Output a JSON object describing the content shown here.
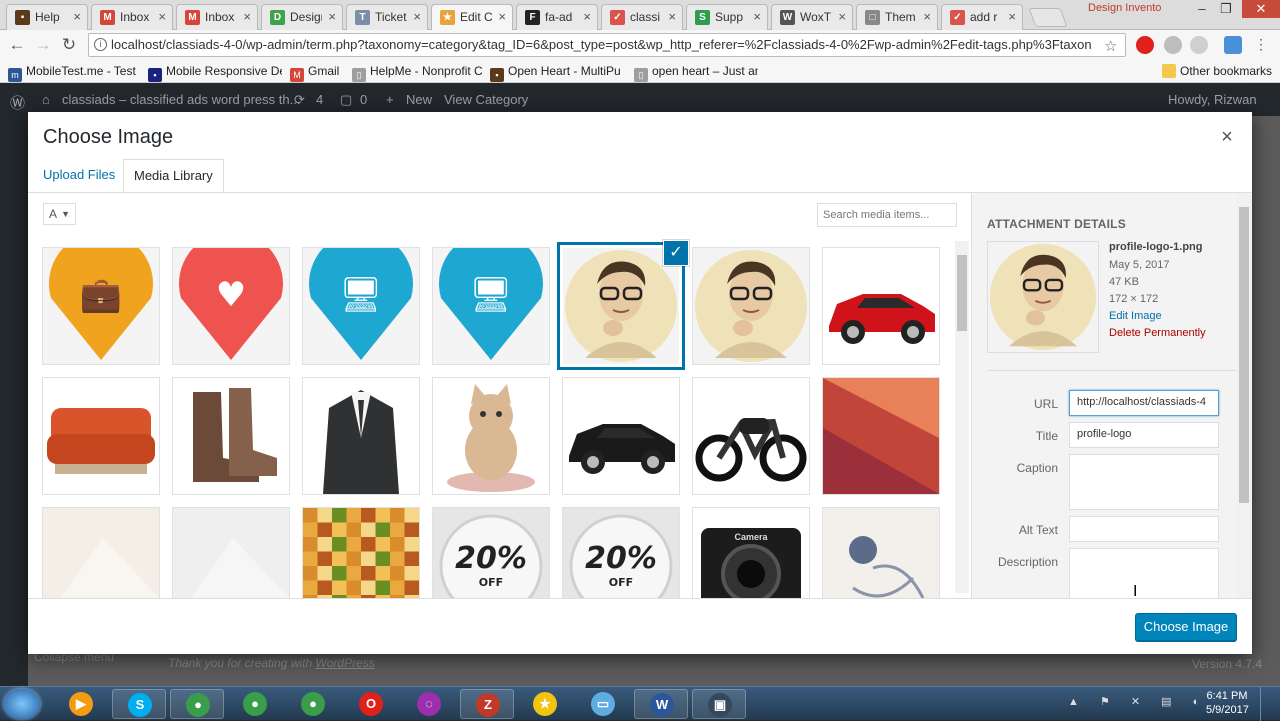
{
  "browser": {
    "tabs": [
      {
        "label": "Help",
        "fav_color": "#5a3a1a",
        "fav": "▪"
      },
      {
        "label": "Inbox",
        "fav_color": "#d44638",
        "fav": "M"
      },
      {
        "label": "Inbox",
        "fav_color": "#d44638",
        "fav": "M"
      },
      {
        "label": "Design",
        "fav_color": "#3ea34a",
        "fav": "D"
      },
      {
        "label": "Ticket",
        "fav_color": "#7a8ea8",
        "fav": "T"
      },
      {
        "label": "Edit C",
        "fav_color": "#e8a33a",
        "fav": "★",
        "active": true
      },
      {
        "label": "fa-ad",
        "fav_color": "#222222",
        "fav": "F"
      },
      {
        "label": "classi",
        "fav_color": "#d9534f",
        "fav": "✓"
      },
      {
        "label": "Supp",
        "fav_color": "#2e9e4d",
        "fav": "S"
      },
      {
        "label": "WoxT",
        "fav_color": "#555555",
        "fav": "W"
      },
      {
        "label": "Them",
        "fav_color": "#888888",
        "fav": "□"
      },
      {
        "label": "add r",
        "fav_color": "#d9534f",
        "fav": "✓"
      }
    ],
    "tab_close": "×",
    "profile_label": "Design Invento",
    "window_controls": {
      "minimize": "–",
      "restore": "❐",
      "close": "✕"
    },
    "nav": {
      "back": "←",
      "forward": "→",
      "reload": "↻"
    },
    "url": "localhost/classiads-4-0/wp-admin/term.php?taxonomy=category&tag_ID=6&post_type=post&wp_http_referer=%2Fclassiads-4-0%2Fwp-admin%2Fedit-tags.php%3Ftaxon",
    "info_icon": "i",
    "star_icon": "☆",
    "bookmarks": [
      {
        "label": "MobileTest.me - Test",
        "color": "#2b5797",
        "fav": "m"
      },
      {
        "label": "Mobile Responsive De",
        "color": "#1a237e",
        "fav": "▪"
      },
      {
        "label": "Gmail",
        "color": "#d44638",
        "fav": "M"
      },
      {
        "label": "HelpMe - Nonprofit C",
        "color": "#9e9e9e",
        "fav": "▯"
      },
      {
        "label": "Open Heart - MultiPu",
        "color": "#5a3a1a",
        "fav": "▪"
      },
      {
        "label": "open heart – Just ano",
        "color": "#9e9e9e",
        "fav": "▯"
      }
    ],
    "other_bookmarks": "Other bookmarks"
  },
  "adminbar": {
    "site": "classiads – classified ads word press th...",
    "updates": "4",
    "comments": "0",
    "new": "New",
    "view": "View Category",
    "howdy": "Howdy, Rizwan"
  },
  "footer": {
    "thanks": "Thank you for creating with",
    "wp_link": "WordPress",
    "version": "Version 4.7.4",
    "collapse": "Collapse menu"
  },
  "modal": {
    "title": "Choose Image",
    "close": "×",
    "tabs": {
      "upload": "Upload Files",
      "library": "Media Library"
    },
    "filter_value": "A",
    "filter_caret": "▼",
    "search_placeholder": "Search media items...",
    "check_icon": "✓",
    "items": [
      {
        "name": "briefcase-pin",
        "kind": "pin",
        "color": "#f0a31e",
        "glyph": "💼"
      },
      {
        "name": "heart-pin",
        "kind": "pin",
        "color": "#ef5350",
        "glyph": "♥"
      },
      {
        "name": "monitor-pin",
        "kind": "pin",
        "color": "#1ea7d1",
        "glyph": "🖥"
      },
      {
        "name": "monitor-pin-2",
        "kind": "pin",
        "color": "#1ea7d1",
        "glyph": "🖥"
      },
      {
        "name": "profile-logo-1",
        "kind": "face",
        "selected": true
      },
      {
        "name": "profile-logo",
        "kind": "face"
      },
      {
        "name": "red-car",
        "kind": "car",
        "color": "#d0121b"
      },
      {
        "name": "orange-sofa",
        "kind": "sofa",
        "color": "#d9542a"
      },
      {
        "name": "brown-boots",
        "kind": "boots",
        "color": "#6b4a3a"
      },
      {
        "name": "black-suit",
        "kind": "suit",
        "color": "#2f3133"
      },
      {
        "name": "kitten",
        "kind": "cat",
        "color": "#d9b893"
      },
      {
        "name": "black-car",
        "kind": "car",
        "color": "#1a1a1a"
      },
      {
        "name": "motorcycle",
        "kind": "bike",
        "color": "#111111"
      },
      {
        "name": "abstract-red",
        "kind": "abstract",
        "color": "#c2453a"
      },
      {
        "name": "pale-texture",
        "kind": "plain",
        "color": "#f4efe6"
      },
      {
        "name": "white-geometric",
        "kind": "plain",
        "color": "#efefef"
      },
      {
        "name": "food-pixel",
        "kind": "food",
        "color": "#e3a43a"
      },
      {
        "name": "discount-20-off",
        "kind": "badge",
        "big": "20%",
        "small": "OFF"
      },
      {
        "name": "discount-20-off-2",
        "kind": "badge",
        "big": "20%",
        "small": "OFF"
      },
      {
        "name": "camera",
        "kind": "camera",
        "label": "Camera"
      },
      {
        "name": "flowers-sketch",
        "kind": "sketch",
        "color": "#f3f0ec"
      }
    ]
  },
  "details": {
    "heading": "ATTACHMENT DETAILS",
    "filename": "profile-logo-1.png",
    "date": "May 5, 2017",
    "size": "47 KB",
    "dimensions": "172 × 172",
    "edit": "Edit Image",
    "delete": "Delete Permanently",
    "fields": {
      "url_label": "URL",
      "url_value": "http://localhost/classiads-4",
      "title_label": "Title",
      "title_value": "profile-logo",
      "caption_label": "Caption",
      "alt_label": "Alt Text",
      "description_label": "Description"
    }
  },
  "choose_button": "Choose Image",
  "taskbar": {
    "time": "6:41 PM",
    "date": "5/9/2017",
    "apps": [
      {
        "name": "media-player",
        "color": "#f39c12",
        "glyph": "▶"
      },
      {
        "name": "skype",
        "color": "#00aff0",
        "glyph": "S",
        "open": true
      },
      {
        "name": "chrome",
        "color": "#3a9d4a",
        "glyph": "●",
        "open": true
      },
      {
        "name": "chrome-2",
        "color": "#3a9d4a",
        "glyph": "●"
      },
      {
        "name": "chrome-3",
        "color": "#3a9d4a",
        "glyph": "●"
      },
      {
        "name": "opera",
        "color": "#e0201b",
        "glyph": "O"
      },
      {
        "name": "messenger",
        "color": "#9b2fae",
        "glyph": "◌"
      },
      {
        "name": "filezilla",
        "color": "#c0392b",
        "glyph": "Z",
        "open": true
      },
      {
        "name": "star-app",
        "color": "#f1c40f",
        "glyph": "★"
      },
      {
        "name": "folder",
        "color": "#5dade2",
        "glyph": "▭"
      },
      {
        "name": "word",
        "color": "#2b579a",
        "glyph": "W",
        "open": true
      },
      {
        "name": "floppy",
        "color": "#34495e",
        "glyph": "▣",
        "open": true
      }
    ],
    "tray": "▲ ⚑ ✕ ▤ ◐"
  }
}
